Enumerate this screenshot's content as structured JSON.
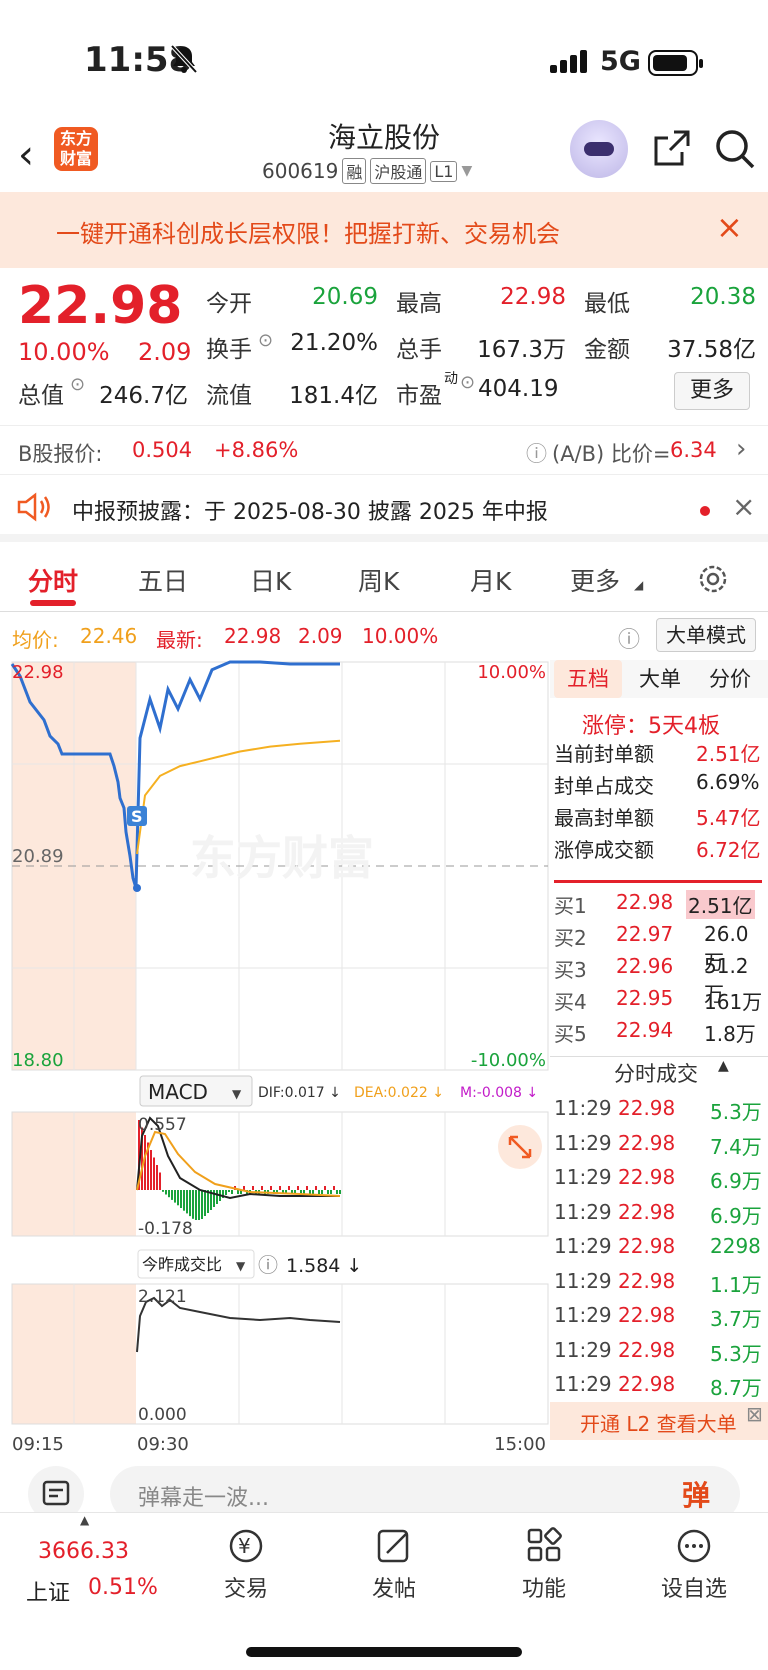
{
  "status": {
    "time": "11:58",
    "network": "5G"
  },
  "header": {
    "title": "海立股份",
    "code": "600619",
    "tags": [
      "融",
      "沪股通",
      "L1"
    ],
    "logo": "东方\n财富"
  },
  "banner": {
    "text": "一键开通科创成长层权限！把握打新、交易机会",
    "close": "×"
  },
  "quote": {
    "price": "22.98",
    "pct": "10.00%",
    "change": "2.09",
    "open_label": "今开",
    "open": "20.69",
    "high_label": "最高",
    "high": "22.98",
    "low_label": "最低",
    "low": "20.38",
    "turnover_label": "换手",
    "turnover": "21.20%",
    "volume_label": "总手",
    "volume": "167.3万",
    "amount_label": "金额",
    "amount": "37.58亿",
    "mcap_label": "总值",
    "mcap": "246.7亿",
    "float_label": "流值",
    "float": "181.4亿",
    "pe_label": "市盈",
    "pe_sup": "动",
    "pe": "404.19",
    "more": "更多"
  },
  "bshare": {
    "label": "B股报价:",
    "price": "0.504",
    "pct": "+8.86%",
    "ratio_label": "(A/B) 比价=",
    "ratio": "6.34"
  },
  "notice": {
    "text": "中报预披露：于 2025-08-30 披露 2025 年中报"
  },
  "tabs": [
    "分时",
    "五日",
    "日K",
    "周K",
    "月K",
    "更多"
  ],
  "avg": {
    "avg_label": "均价:",
    "avg": "22.46",
    "latest_label": "最新:",
    "latest": "22.98",
    "chg": "2.09",
    "pct": "10.00%",
    "mode": "大单模式"
  },
  "chart_data": {
    "type": "line",
    "price_axis": {
      "top": "22.98",
      "mid": "20.89",
      "bottom": "18.80",
      "top_pct": "10.00%",
      "bottom_pct": "-10.00%"
    },
    "time_axis": [
      "09:15",
      "09:30",
      "15:00"
    ],
    "watermark": "东方财富",
    "marker": "S",
    "macd": {
      "label": "MACD",
      "dif": "DIF:0.017 ↓",
      "dea": "DEA:0.022 ↓",
      "m": "M:-0.008 ↓",
      "top": "0.557",
      "bottom": "-0.178"
    },
    "vol_ratio": {
      "label": "今昨成交比",
      "value": "1.584 ↓",
      "top": "2.121",
      "bottom": "0.000"
    },
    "price_series": [
      22.98,
      22.7,
      22.4,
      22.2,
      22.15,
      22.15,
      22.15,
      22.1,
      21.6,
      21.1,
      20.69,
      22.2,
      22.6,
      22.3,
      22.7,
      22.5,
      22.8,
      22.6,
      22.9,
      22.98,
      22.98
    ],
    "avg_series": [
      21.3,
      21.9,
      22.1,
      22.2,
      22.25,
      22.3,
      22.35,
      22.4,
      22.43,
      22.46
    ]
  },
  "side_tabs": [
    "五档",
    "大单",
    "分价"
  ],
  "limit": {
    "title": "涨停：5天4板",
    "rows": [
      [
        "当前封单额",
        "2.51亿"
      ],
      [
        "封单占成交",
        "6.69%"
      ],
      [
        "最高封单额",
        "5.47亿"
      ],
      [
        "涨停成交额",
        "6.72亿"
      ]
    ]
  },
  "book": [
    [
      "买1",
      "22.98",
      "2.51亿"
    ],
    [
      "买2",
      "22.97",
      "26.0万"
    ],
    [
      "买3",
      "22.96",
      "51.2万"
    ],
    [
      "买4",
      "22.95",
      "161万"
    ],
    [
      "买5",
      "22.94",
      "1.8万"
    ]
  ],
  "trades_title": "分时成交",
  "trades": [
    [
      "11:29",
      "22.98",
      "5.3万"
    ],
    [
      "11:29",
      "22.98",
      "7.4万"
    ],
    [
      "11:29",
      "22.98",
      "6.9万"
    ],
    [
      "11:29",
      "22.98",
      "6.9万"
    ],
    [
      "11:29",
      "22.98",
      "2298"
    ],
    [
      "11:29",
      "22.98",
      "1.1万"
    ],
    [
      "11:29",
      "22.98",
      "3.7万"
    ],
    [
      "11:29",
      "22.98",
      "5.3万"
    ],
    [
      "11:29",
      "22.98",
      "8.7万"
    ]
  ],
  "l2": "开通 L2 查看大单",
  "danmu": {
    "placeholder": "弹幕走一波...",
    "btn": "弹"
  },
  "nav": {
    "index_value": "3666.33",
    "index_name": "上证",
    "index_pct": "0.51%",
    "items": [
      "交易",
      "发帖",
      "功能",
      "设自选"
    ]
  }
}
